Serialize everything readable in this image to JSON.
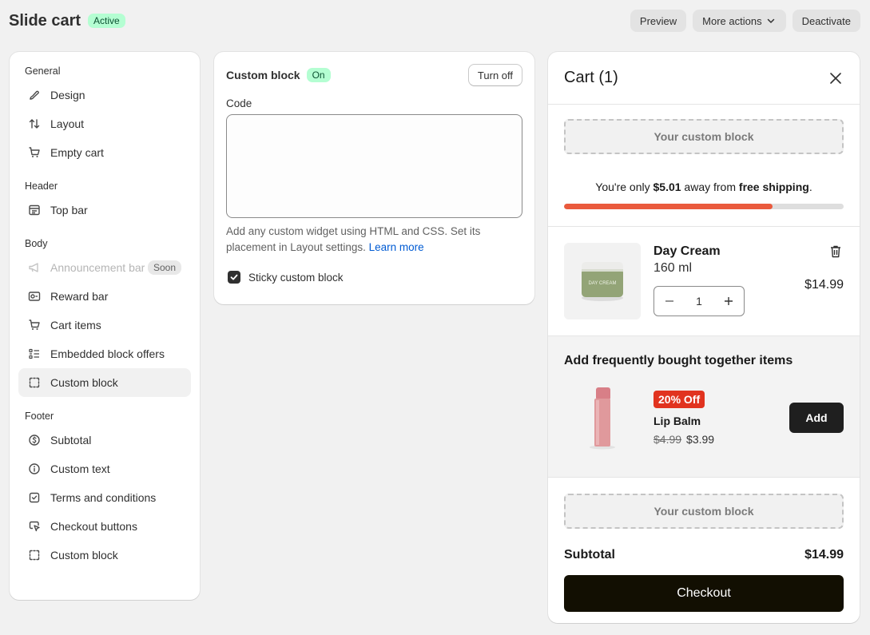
{
  "page": {
    "title": "Slide cart",
    "status": "Active"
  },
  "header_actions": {
    "preview": "Preview",
    "more_actions": "More actions",
    "deactivate": "Deactivate"
  },
  "sidebar": {
    "general": {
      "title": "General",
      "items": [
        "Design",
        "Layout",
        "Empty cart"
      ]
    },
    "header": {
      "title": "Header",
      "items": [
        "Top bar"
      ]
    },
    "body": {
      "title": "Body",
      "items": [
        "Announcement bar",
        "Reward bar",
        "Cart items",
        "Embedded block offers",
        "Custom block"
      ],
      "soon_label": "Soon"
    },
    "footer": {
      "title": "Footer",
      "items": [
        "Subtotal",
        "Custom text",
        "Terms and conditions",
        "Checkout buttons",
        "Custom block"
      ]
    }
  },
  "editor": {
    "title": "Custom block",
    "status": "On",
    "turn_off": "Turn off",
    "code_label": "Code",
    "code_value": "",
    "help_text": "Add any custom widget using HTML and CSS. Set its placement in Layout settings.",
    "learn_more": "Learn more",
    "sticky_label": "Sticky custom block",
    "sticky_checked": true
  },
  "cart": {
    "title": "Cart (1)",
    "custom_block_label": "Your custom block",
    "shipping": {
      "prefix": "You're only ",
      "amount": "$5.01",
      "middle": " away from ",
      "goal": "free shipping",
      "suffix": ".",
      "progress": 0.745,
      "color": "#ea5a3d"
    },
    "item": {
      "name": "Day Cream",
      "variant": "160 ml",
      "quantity": "1",
      "price": "$14.99",
      "product_label": "DAY CREAM"
    },
    "fbt": {
      "title": "Add frequently bought together items",
      "badge": "20% Off",
      "name": "Lip Balm",
      "old_price": "$4.99",
      "price": "$3.99",
      "add": "Add"
    },
    "subtotal_label": "Subtotal",
    "subtotal_value": "$14.99",
    "checkout": "Checkout"
  }
}
